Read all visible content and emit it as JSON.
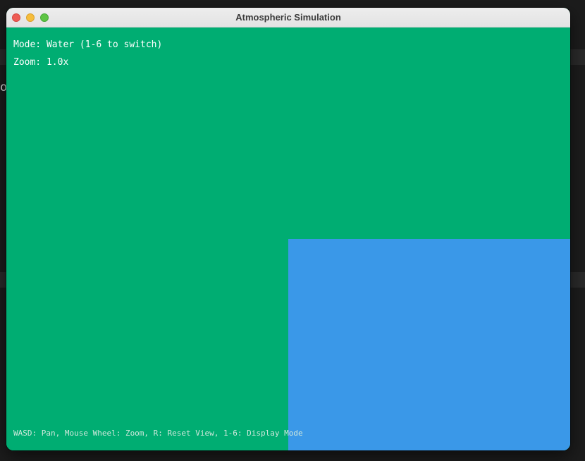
{
  "window": {
    "title": "Atmospheric Simulation"
  },
  "hud": {
    "mode_text": "Mode: Water (1-6 to switch)",
    "zoom_text": "Zoom: 1.0x"
  },
  "help_text": "WASD: Pan, Mouse Wheel: Zoom, R: Reset View, 1-6: Display Mode",
  "background": {
    "glyph": "ok"
  },
  "colors": {
    "land": "#00ad72",
    "water": "#3a98e8"
  },
  "icons": [
    "close-icon",
    "minimize-icon",
    "zoom-icon"
  ]
}
